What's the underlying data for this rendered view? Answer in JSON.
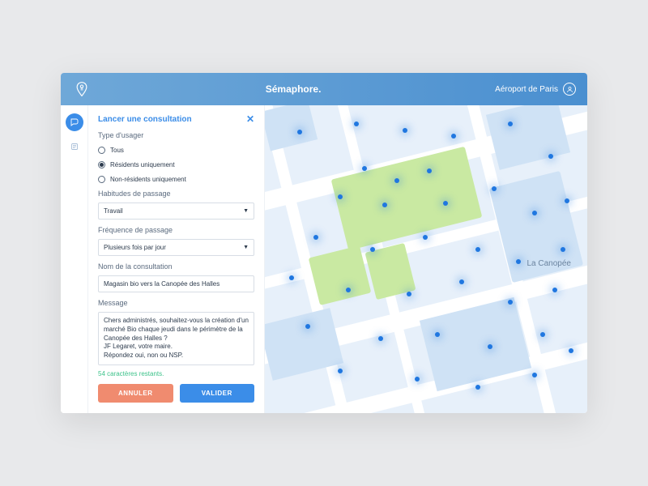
{
  "header": {
    "title": "Sémaphore.",
    "user": "Aéroport de Paris"
  },
  "panel": {
    "title": "Lancer une consultation",
    "close": "✕",
    "user_type": {
      "label": "Type d'usager",
      "options": [
        "Tous",
        "Résidents uniquement",
        "Non-résidents uniquement"
      ],
      "selected": 1
    },
    "habit": {
      "label": "Habitudes de passage",
      "value": "Travail"
    },
    "freq": {
      "label": "Fréquence de passage",
      "value": "Plusieurs fois par jour"
    },
    "name": {
      "label": "Nom de la consultation",
      "value": "Magasin bio vers la Canopée des Halles"
    },
    "message": {
      "label": "Message",
      "value": "Chers administrés, souhaitez-vous la création d'un marché Bio chaque jeudi dans le périmètre de la Canopée des Halles ?\nJF Legaret, votre maire.\nRépondez oui, non ou NSP."
    },
    "chars_left": "54 caractères restants.",
    "cancel": "Annuler",
    "validate": "Valider"
  },
  "map": {
    "label": "La Canopée"
  }
}
